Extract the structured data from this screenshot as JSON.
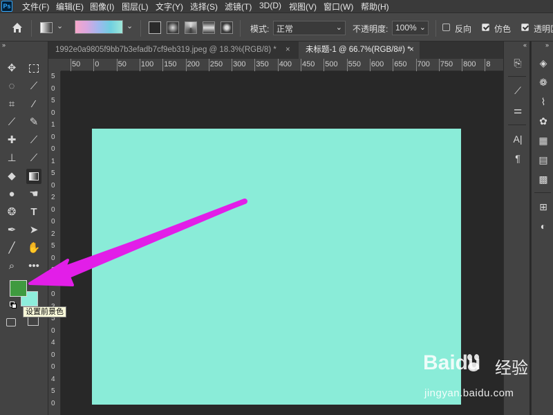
{
  "menu": {
    "app_logo": "Ps",
    "items": [
      "文件(F)",
      "编辑(E)",
      "图像(I)",
      "图层(L)",
      "文字(Y)",
      "选择(S)",
      "滤镜(T)",
      "3D(D)",
      "视图(V)",
      "窗口(W)",
      "帮助(H)"
    ]
  },
  "options": {
    "mode_label": "模式:",
    "mode_value": "正常",
    "opacity_label": "不透明度:",
    "opacity_value": "100%",
    "reverse_label": "反向",
    "dither_label": "仿色",
    "transparency_label": "透明区"
  },
  "tabs": [
    {
      "label": "1992e0a9805f9bb7b3efadb7cf9eb319.jpeg @ 18.3%(RGB/8) *",
      "close": "×"
    },
    {
      "label": "未标题-1 @ 66.7%(RGB/8#) *",
      "close": "×"
    }
  ],
  "ruler": {
    "h_ticks": [
      "50",
      "0",
      "50",
      "100",
      "150",
      "200",
      "250",
      "300",
      "350",
      "400",
      "450",
      "500",
      "550",
      "600",
      "650",
      "700",
      "750",
      "800",
      "8"
    ],
    "v_ticks": [
      "5",
      "0",
      "5",
      "0",
      "1",
      "0",
      "0",
      "1",
      "5",
      "0",
      "2",
      "0",
      "0",
      "2",
      "5",
      "0",
      "3",
      "0",
      "0",
      "3",
      "5",
      "0",
      "4",
      "0",
      "0",
      "4",
      "5",
      "0"
    ]
  },
  "colors": {
    "foreground": "#3f9a3f",
    "background": "#8eeddb",
    "canvas_fill": "#8aecd8",
    "arrow": "#e21ee8"
  },
  "tooltip": "设置前景色",
  "watermark": {
    "brand": "Baidu",
    "brand_cn": "经验",
    "url": "jingyan.baidu.com"
  },
  "tool_icons": [
    "move-icon",
    "marquee-icon",
    "lasso-icon",
    "magic-wand-icon",
    "crop-icon",
    "eyedropper-icon",
    "brush-icon",
    "pencil-icon",
    "healing-icon",
    "brush-alt-icon",
    "stamp-icon",
    "history-brush-icon",
    "eraser-icon",
    "gradient-icon",
    "blur-icon",
    "smudge-icon",
    "dodge-icon",
    "type-icon",
    "pen-icon",
    "path-select-icon",
    "line-icon",
    "hand-icon",
    "zoom-icon",
    "more-icon"
  ]
}
